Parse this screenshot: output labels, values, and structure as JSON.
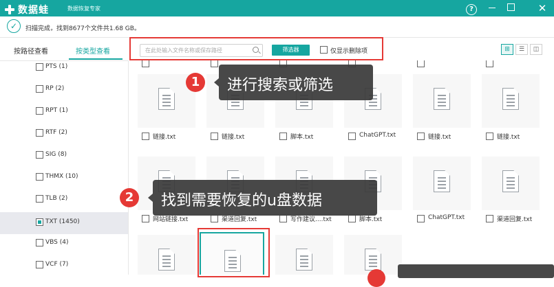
{
  "app": {
    "title": "数据蛙",
    "subtitle": "数据恢复专家",
    "help": "?",
    "close": "✕"
  },
  "status": {
    "text": "扫描完成，找到8677个文件共1.68 GB。"
  },
  "view_tabs": [
    {
      "label": "按路径查看",
      "active": false
    },
    {
      "label": "按类型查看",
      "active": true
    }
  ],
  "sidebar": {
    "items": [
      {
        "label": "PTS (1)",
        "checked": false
      },
      {
        "label": "RP (2)",
        "checked": false
      },
      {
        "label": "RPT (1)",
        "checked": false
      },
      {
        "label": "RTF (2)",
        "checked": false
      },
      {
        "label": "SIG (8)",
        "checked": false
      },
      {
        "label": "THMX (10)",
        "checked": false
      },
      {
        "label": "TLB (2)",
        "checked": false
      },
      {
        "label": "TXT (1450)",
        "checked": true,
        "selected": true
      },
      {
        "label": "VBS (4)",
        "checked": false
      },
      {
        "label": "VCF (7)",
        "checked": false
      }
    ]
  },
  "toolbar": {
    "search_placeholder": "在此处输入文件名称或保存路径",
    "filter_label": "筛选器",
    "only_deleted_label": "仅显示删除项",
    "view_grid": "⊞",
    "view_list": "☰",
    "view_detail": "◫"
  },
  "files": {
    "row1": [
      "链接.txt",
      "链接.txt",
      "脚本.txt",
      "ChatGPT.txt",
      "链接.txt",
      "链接.txt"
    ],
    "row2": [
      "网站链接.txt",
      "渠道回复.txt",
      "写作建议....txt",
      "脚本.txt",
      "ChatGPT.txt",
      "渠道回复.txt"
    ]
  },
  "callouts": [
    {
      "num": "1",
      "text": "进行搜索或筛选"
    },
    {
      "num": "2",
      "text": "找到需要恢复的u盘数据"
    }
  ],
  "colors": {
    "accent": "#16a6a0",
    "highlight": "#e53935"
  }
}
